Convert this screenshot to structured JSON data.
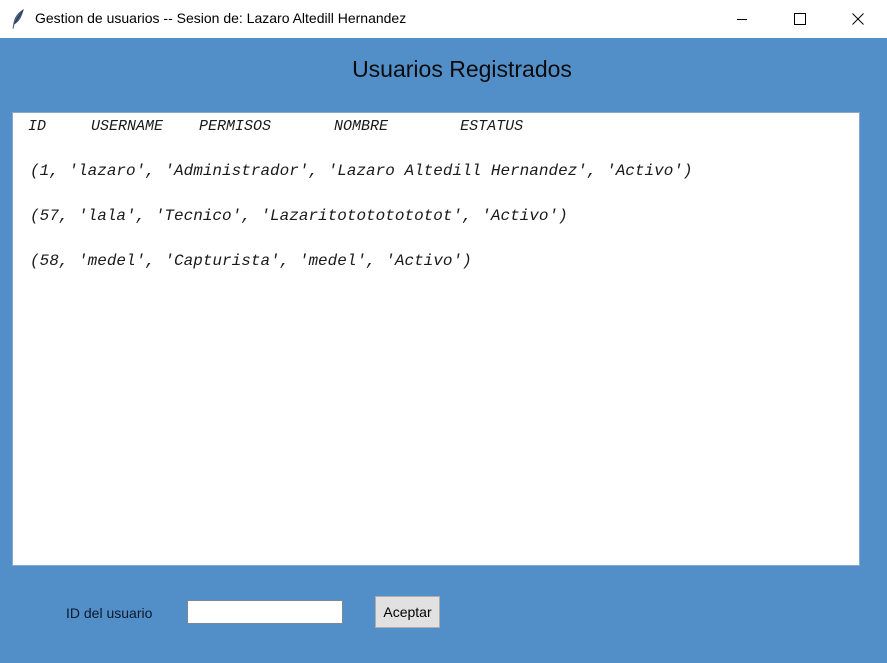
{
  "window": {
    "title": "Gestion de usuarios -- Sesion de: Lazaro Altedill Hernandez",
    "icon": "feather-icon",
    "controls": [
      "minimize-icon",
      "maximize-icon",
      "close-icon"
    ]
  },
  "heading": "Usuarios Registrados",
  "list": {
    "header": "ID     USERNAME    PERMISOS       NOMBRE        ESTATUS",
    "rows": [
      "(1, 'lazaro', 'Administrador', 'Lazaro Altedill Hernandez', 'Activo')",
      "(57, 'lala', 'Tecnico', 'Lazaritotototototot', 'Activo')",
      "(58, 'medel', 'Capturista', 'medel', 'Activo')"
    ]
  },
  "form": {
    "id_label": "ID del usuario",
    "id_value": "",
    "accept_label": "Aceptar"
  },
  "colors": {
    "background": "#528fc9",
    "titlebar": "#ffffff",
    "listbox": "#ffffff",
    "button": "#e1e1e1"
  }
}
